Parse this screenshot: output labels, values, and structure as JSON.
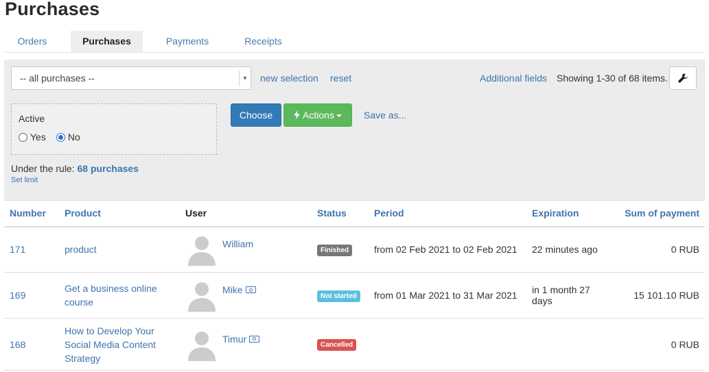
{
  "page_title": "Purchases",
  "tabs": [
    {
      "label": "Orders"
    },
    {
      "label": "Purchases",
      "active": true
    },
    {
      "label": "Payments"
    },
    {
      "label": "Receipts"
    }
  ],
  "filter": {
    "select_value": "-- all purchases --",
    "new_selection": "new selection",
    "reset": "reset",
    "additional_fields": "Additional fields",
    "showing": "Showing 1-30 of 68 items.",
    "rule": {
      "label": "Active",
      "options": [
        {
          "label": "Yes",
          "checked": false
        },
        {
          "label": "No",
          "checked": true
        }
      ]
    },
    "choose": "Choose",
    "actions": "Actions",
    "save_as": "Save as...",
    "under_rule_prefix": "Under the rule:",
    "under_rule_count": "68 purchases",
    "set_limit": "Set limit"
  },
  "table": {
    "columns": [
      "Number",
      "Product",
      "User",
      "Status",
      "Period",
      "Expiration",
      "Sum of payment"
    ],
    "rows": [
      {
        "number": "171",
        "product": "product",
        "user": "William",
        "money_icon": false,
        "status": "Finished",
        "status_color": "#777777",
        "period": "from 02 Feb 2021 to 02 Feb 2021",
        "expiration": "22 minutes ago",
        "sum": "0 RUB"
      },
      {
        "number": "169",
        "product": "Get a business online course",
        "user": "Mike",
        "money_icon": true,
        "status": "Not started",
        "status_color": "#5bc0de",
        "period": "from 01 Mar 2021 to 31 Mar 2021",
        "expiration": "in 1 month 27 days",
        "sum": "15 101.10 RUB"
      },
      {
        "number": "168",
        "product": "How to Develop Your Social Media Content Strategy",
        "user": "Timur",
        "money_icon": true,
        "status": "Cancelled",
        "status_color": "#d9534f",
        "period": "",
        "expiration": "",
        "sum": "0 RUB"
      }
    ]
  }
}
